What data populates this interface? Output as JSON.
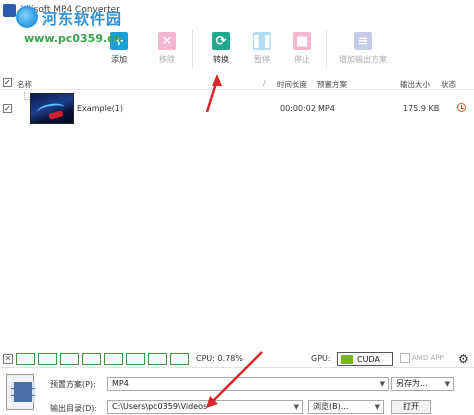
{
  "window": {
    "title": "Xilisoft MP4 Converter"
  },
  "watermark": {
    "line1": "河东软件园",
    "line2": "www.pc0359.cn"
  },
  "toolbar": {
    "add": "添加",
    "remove": "移除",
    "convert": "转换",
    "pause": "暂停",
    "stop": "停止",
    "add_profile": "增加输出方案"
  },
  "list": {
    "columns": {
      "name": "名称",
      "duration": "时间长度",
      "profile": "预置方案",
      "output_size": "输出大小",
      "status": "状态"
    },
    "rows": [
      {
        "name": "Example(1)",
        "duration": "00:00:02",
        "profile": "MP4",
        "size": "175.9 KB"
      }
    ]
  },
  "status_bar": {
    "cpu": "CPU: 0.78%",
    "gpu_label": "GPU:",
    "cuda": "CUDA",
    "amd": "AMD APP"
  },
  "bottom": {
    "profile_label": "预置方案(P):",
    "profile_value": "MP4",
    "save_as": "另存为...",
    "output_label": "输出目录(D):",
    "output_value": "C:\\Users\\pc0359\\Videos",
    "browse": "浏览(B)...",
    "open": "打开"
  },
  "colors": {
    "add": "#1a9fd6",
    "remove": "#e0337a",
    "convert": "#23a88f",
    "pause": "#2f9fdc",
    "stop": "#e0337a",
    "add_profile": "#5b6cc4",
    "annotation_arrow": "#d8262a"
  },
  "icons": {
    "add": "plus-icon",
    "remove": "x-icon",
    "convert": "refresh-icon",
    "pause": "pause-icon",
    "stop": "stop-icon",
    "add_profile": "document-icon"
  }
}
